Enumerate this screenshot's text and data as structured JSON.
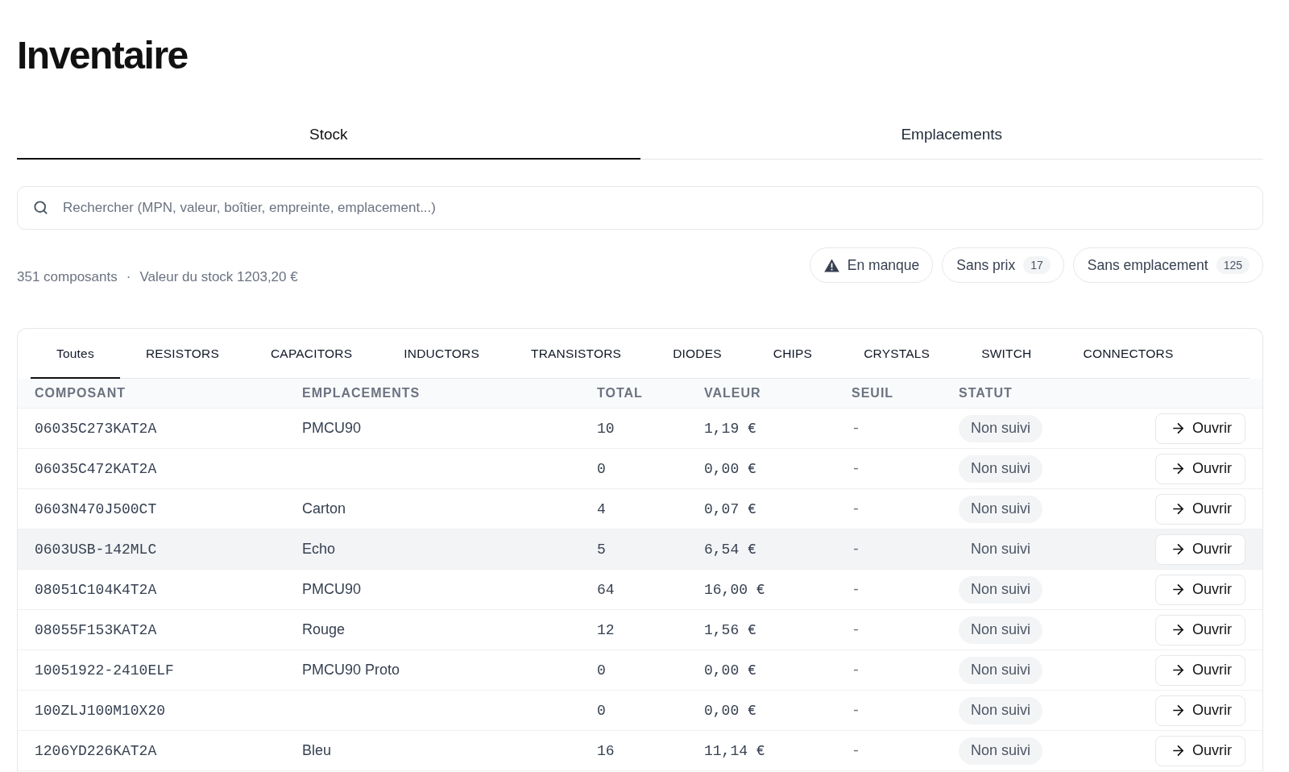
{
  "page": {
    "title": "Inventaire"
  },
  "view_tabs": [
    {
      "label": "Stock",
      "selected": true
    },
    {
      "label": "Emplacements",
      "selected": false
    }
  ],
  "search": {
    "placeholder": "Rechercher (MPN, valeur, boîtier, empreinte, emplacement...)"
  },
  "summary": {
    "count": "351 composants",
    "separator": "·",
    "stock_value": "Valeur du stock 1203,20 €"
  },
  "filters": [
    {
      "kind": "warning",
      "label": "En manque"
    },
    {
      "kind": "count",
      "label": "Sans prix",
      "count": "17"
    },
    {
      "kind": "count",
      "label": "Sans emplacement",
      "count": "125"
    }
  ],
  "category_tabs": [
    {
      "label": "Toutes",
      "selected": true
    },
    {
      "label": "RESISTORS",
      "selected": false
    },
    {
      "label": "CAPACITORS",
      "selected": false
    },
    {
      "label": "INDUCTORS",
      "selected": false
    },
    {
      "label": "TRANSISTORS",
      "selected": false
    },
    {
      "label": "DIODES",
      "selected": false
    },
    {
      "label": "CHIPS",
      "selected": false
    },
    {
      "label": "CRYSTALS",
      "selected": false
    },
    {
      "label": "SWITCH",
      "selected": false
    },
    {
      "label": "CONNECTORS",
      "selected": false
    }
  ],
  "table": {
    "columns": [
      "COMPOSANT",
      "EMPLACEMENTS",
      "TOTAL",
      "VALEUR",
      "SEUIL",
      "STATUT"
    ],
    "rows": [
      {
        "composant": "06035C273KAT2A",
        "emplacements": "PMCU90",
        "total": "10",
        "valeur": "1,19 €",
        "seuil": "-",
        "statut": "Non suivi",
        "action": "Ouvrir",
        "hovered": false
      },
      {
        "composant": "06035C472KAT2A",
        "total": "0",
        "valeur": "0,00 €",
        "seuil": "-",
        "statut": "Non suivi",
        "action": "Ouvrir",
        "hovered": false
      },
      {
        "composant": "0603N470J500CT",
        "emplacements": "Carton",
        "total": "4",
        "valeur": "0,07 €",
        "seuil": "-",
        "statut": "Non suivi",
        "action": "Ouvrir",
        "hovered": false
      },
      {
        "composant": "0603USB-142MLC",
        "emplacements": "Echo",
        "total": "5",
        "valeur": "6,54 €",
        "seuil": "-",
        "statut": "Non suivi",
        "action": "Ouvrir",
        "hovered": true
      },
      {
        "composant": "08051C104K4T2A",
        "emplacements": "PMCU90",
        "total": "64",
        "valeur": "16,00 €",
        "seuil": "-",
        "statut": "Non suivi",
        "action": "Ouvrir",
        "hovered": false
      },
      {
        "composant": "08055F153KAT2A",
        "emplacements": "Rouge",
        "total": "12",
        "valeur": "1,56 €",
        "seuil": "-",
        "statut": "Non suivi",
        "action": "Ouvrir",
        "hovered": false
      },
      {
        "composant": "10051922-2410ELF",
        "emplacements": "PMCU90 Proto",
        "total": "0",
        "valeur": "0,00 €",
        "seuil": "-",
        "statut": "Non suivi",
        "action": "Ouvrir",
        "hovered": false
      },
      {
        "composant": "100ZLJ100M10X20",
        "total": "0",
        "valeur": "0,00 €",
        "seuil": "-",
        "statut": "Non suivi",
        "action": "Ouvrir",
        "hovered": false
      },
      {
        "composant": "1206YD226KAT2A",
        "emplacements": "Bleu",
        "total": "16",
        "valeur": "11,14 €",
        "seuil": "-",
        "statut": "Non suivi",
        "action": "Ouvrir",
        "hovered": false
      }
    ]
  }
}
